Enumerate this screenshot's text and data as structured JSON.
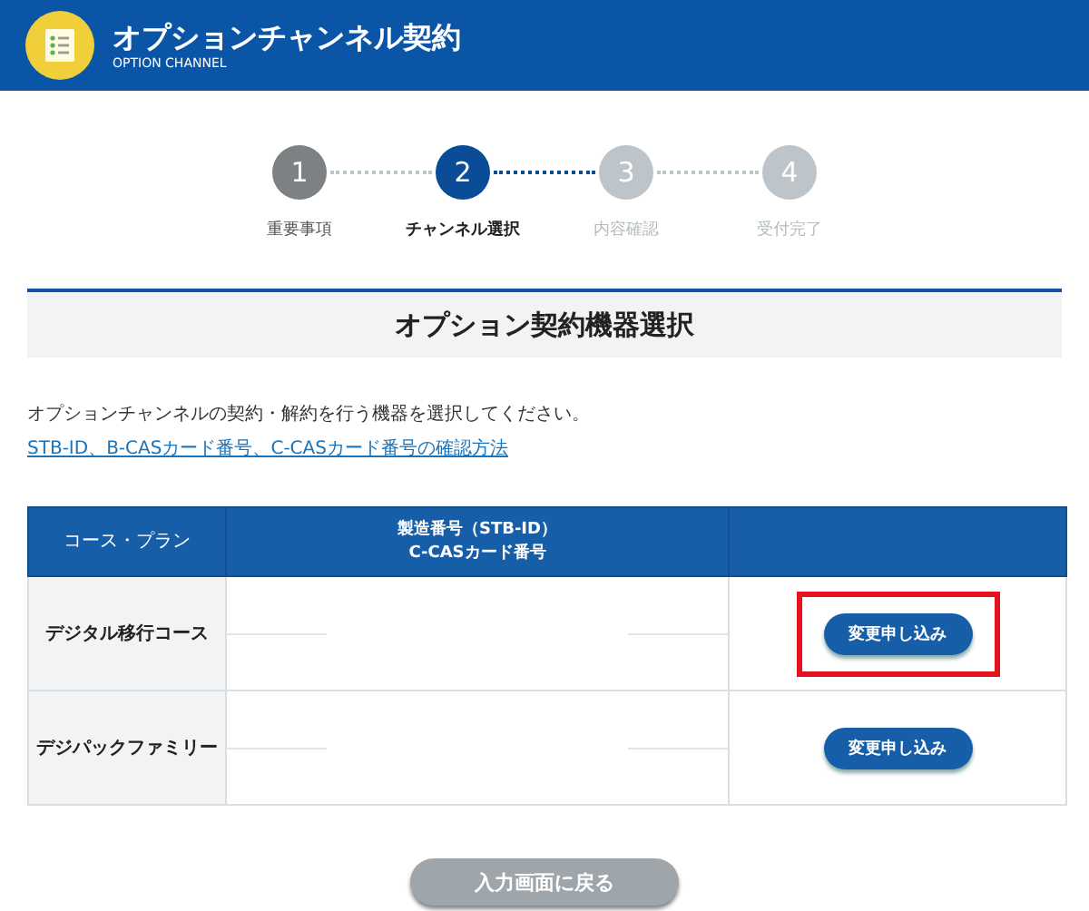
{
  "header": {
    "title": "オプションチャンネル契約",
    "subtitle": "OPTION CHANNEL"
  },
  "steps": [
    {
      "number": "1",
      "label": "重要事項",
      "completed": true,
      "selected": false
    },
    {
      "number": "2",
      "label": "チャンネル選択",
      "completed": false,
      "selected": true
    },
    {
      "number": "3",
      "label": "内容確認",
      "completed": false,
      "selected": false
    },
    {
      "number": "4",
      "label": "受付完了",
      "completed": false,
      "selected": false
    }
  ],
  "section_title": "オプション契約機器選択",
  "instruction": "オプションチャンネルの契約・解約を行う機器を選択してください。",
  "help_link": "STB-ID、B-CASカード番号、C-CASカード番号の確認方法",
  "table": {
    "columns": [
      "コース・プラン",
      "製造番号（STB-ID）\nC-CASカード番号"
    ],
    "rows": [
      {
        "plan": "デジタル移行コース",
        "button": "変更申し込み",
        "highlighted": true
      },
      {
        "plan": "デジパックファミリー",
        "button": "変更申し込み",
        "highlighted": false
      }
    ]
  },
  "back_button": "入力画面に戻る"
}
